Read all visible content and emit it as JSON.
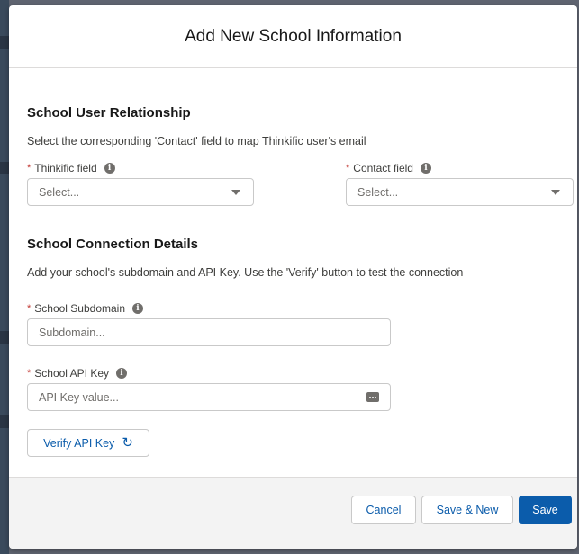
{
  "modal": {
    "title": "Add New School Information"
  },
  "relationship": {
    "title": "School User Relationship",
    "description": "Select the corresponding 'Contact' field to map Thinkific user's email",
    "thinkific_field": {
      "required_mark": "*",
      "label": "Thinkific field",
      "value": "Select..."
    },
    "contact_field": {
      "required_mark": "*",
      "label": "Contact field",
      "value": "Select..."
    }
  },
  "connection": {
    "title": "School Connection Details",
    "description": "Add your school's subdomain and API Key. Use the 'Verify' button to test the connection",
    "subdomain": {
      "required_mark": "*",
      "label": "School Subdomain",
      "placeholder": "Subdomain..."
    },
    "api_key": {
      "required_mark": "*",
      "label": "School API Key",
      "placeholder": "API Key value..."
    },
    "verify_label": "Verify API Key"
  },
  "footer": {
    "cancel_label": "Cancel",
    "save_new_label": "Save & New",
    "save_label": "Save"
  },
  "icons": {
    "info": "info-icon",
    "caret": "chevron-down-icon",
    "key": "key-masked-icon",
    "refresh": "refresh-icon"
  },
  "colors": {
    "brand": "#0b5cab",
    "required": "#c23934",
    "footer_bg": "#f3f3f3"
  }
}
